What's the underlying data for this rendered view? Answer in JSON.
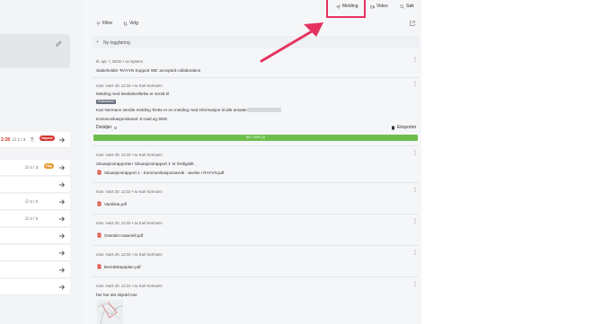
{
  "toolbar": {
    "filter_label": "Filtre",
    "choose_label": "Velg",
    "message_label": "Melding",
    "video_label": "Video",
    "search_label": "Søk"
  },
  "new_log": {
    "placeholder": "Ny loggføring"
  },
  "left_list": {
    "rows": [
      {
        "time": "2:28",
        "count": "2 / 3",
        "extra": "",
        "badge": "Høyest"
      },
      {
        "time": "",
        "count": "0 / 3",
        "extra": "",
        "badge": "Høy"
      },
      {
        "time": "",
        "count": "",
        "extra": "",
        "badge": ""
      },
      {
        "time": "",
        "count": "0 / 2",
        "extra": "",
        "badge": ""
      },
      {
        "time": "",
        "count": "0 / 5",
        "extra": "",
        "badge": ""
      },
      {
        "time": "",
        "count": "",
        "extra": "",
        "badge": ""
      },
      {
        "time": "",
        "count": "",
        "extra": "",
        "badge": ""
      },
      {
        "time": "",
        "count": "",
        "extra": "",
        "badge": ""
      },
      {
        "time": "",
        "count": "",
        "extra": "",
        "badge": ""
      }
    ]
  },
  "entries": [
    {
      "meta": "til. apr. 7, 08:52 • av System",
      "text": "Stakeholder 'RAYVN Support WE' accepted collaboration"
    },
    {
      "meta": "man. mars 30, 12:34 • av Kari Normann",
      "text": "Melding med lesebekreftelse er sendt til",
      "tag": "Kristiansand",
      "text2": "Kari Normann sendte melding 'Dette er en melding med informasjon til alle ansatte.' til",
      "text3": "Kommunikasjonskanal: E-mail og SMS",
      "details_label": "Detaljer",
      "export_label": "Eksporter",
      "progress_label": "Ble: 100% (1)",
      "progress_value": 1.0
    },
    {
      "meta": "man. mars 30, 12:33 • av Kari Normann",
      "text": "Situasjonsrapporten 'Situasjonsrapport 1' er ferdigstilt.",
      "file": "Situasjonsrapport 1 - Kommunikasjonsavvik - øvelse i RAYVN.pdf"
    },
    {
      "meta": "man. mars 30, 12:32 • av Kari Normann",
      "file": "Varsliste.pdf"
    },
    {
      "meta": "man. mars 30, 12:32 • av Kari Normann",
      "file": "Oversikt materiell.pdf"
    },
    {
      "meta": "man. mars 30, 12:32 • av Kari Normann",
      "file": "Beredskapsplan.pdf"
    },
    {
      "meta": "man. mars 30, 12:31 • av Kari Normann",
      "text": "her har det skjedd noe"
    }
  ],
  "colors": {
    "accent_pink": "#e4325f",
    "progress_green": "#6dbf4b",
    "badge_red": "#d0342c",
    "badge_orange": "#e8962e",
    "pdf_red": "#d9483b"
  }
}
